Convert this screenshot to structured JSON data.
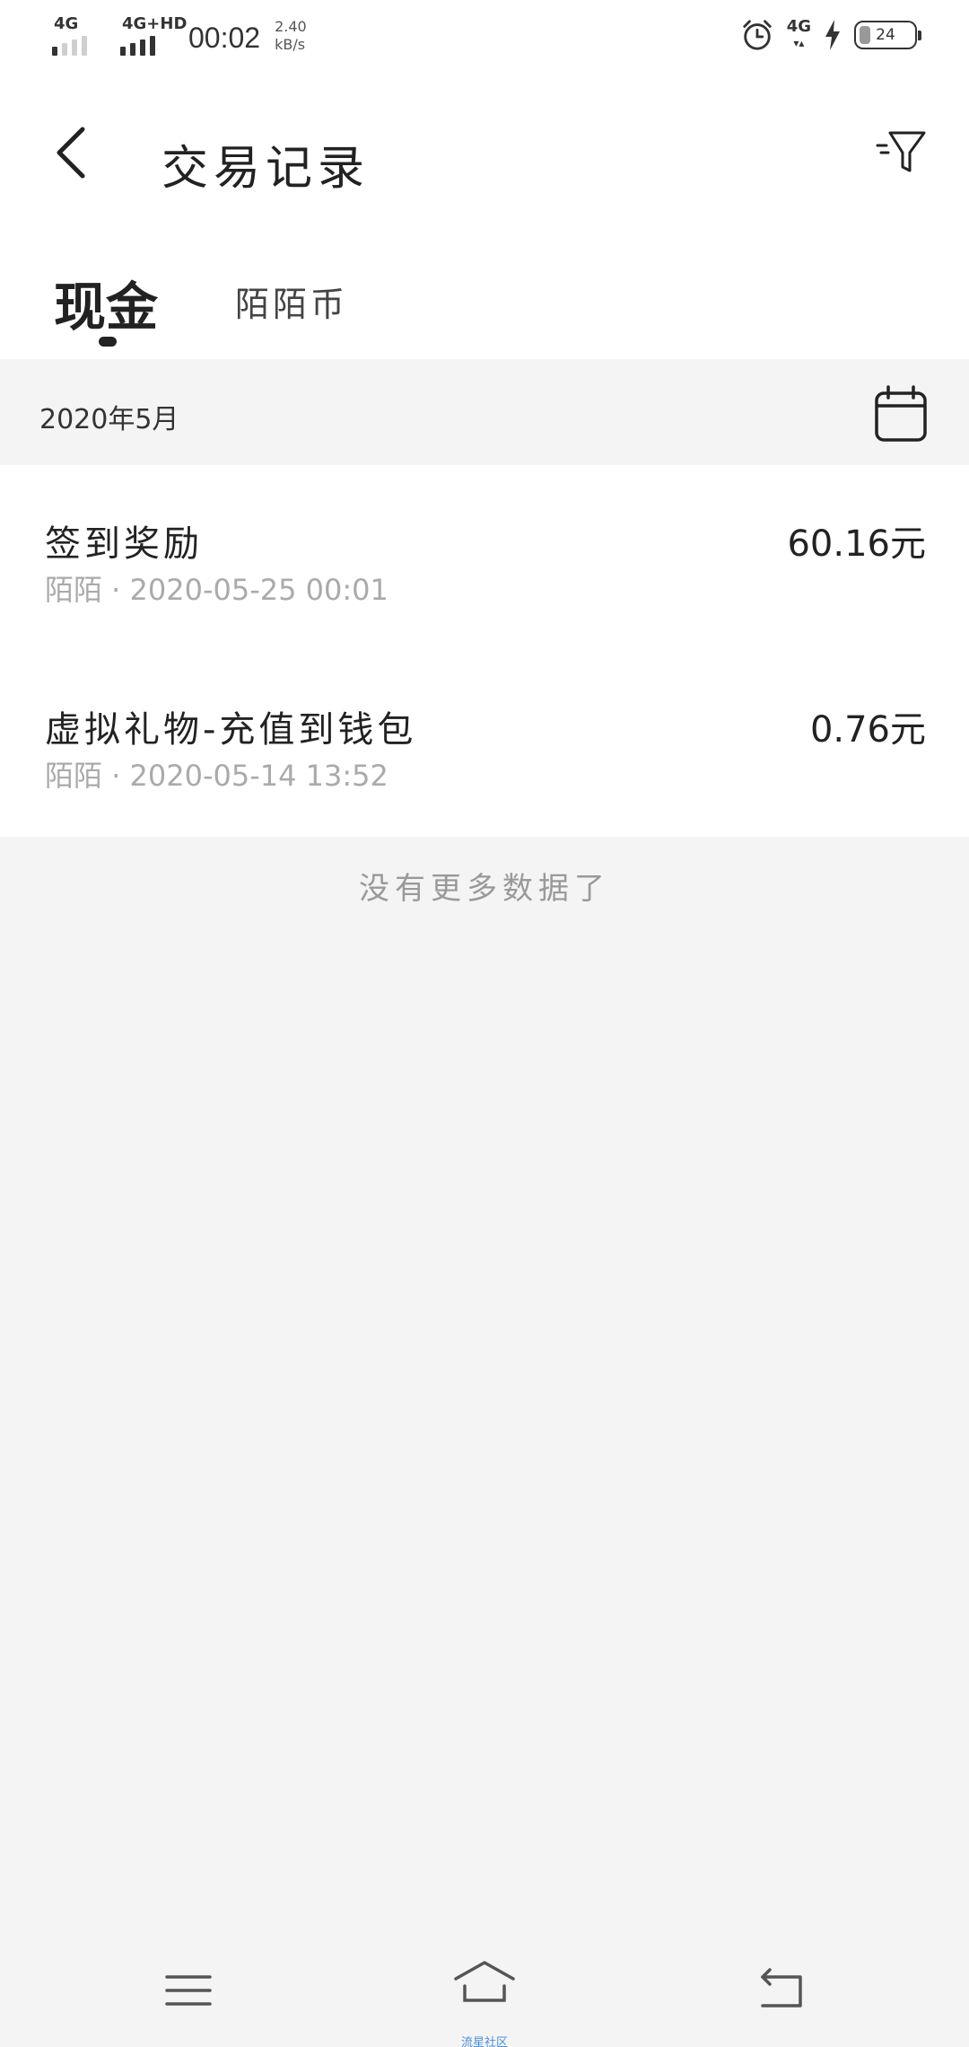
{
  "status_bar": {
    "sim1_network": "4G",
    "sim2_network": "4G+HD",
    "time": "00:02",
    "speed_value": "2.40",
    "speed_unit": "kB/s",
    "right_network": "4G",
    "battery_level": "24"
  },
  "header": {
    "title": "交易记录"
  },
  "tabs": [
    {
      "label": "现金",
      "active": true
    },
    {
      "label": "陌陌币",
      "active": false
    }
  ],
  "month": {
    "label": "2020年5月"
  },
  "transactions": [
    {
      "title": "签到奖励",
      "meta": "陌陌 · 2020-05-25 00:01",
      "amount": "60.16元"
    },
    {
      "title": "虚拟礼物-充值到钱包",
      "meta": "陌陌 · 2020-05-14 13:52",
      "amount": "0.76元"
    }
  ],
  "footer": {
    "no_more_text": "没有更多数据了"
  },
  "nav_bar": {
    "sub_label": "流星社区"
  },
  "colors": {
    "background": "#f4f4f4",
    "card": "#ffffff",
    "text_primary": "#222222",
    "text_secondary": "#aaaaaa"
  },
  "icons": {
    "back": "back-icon",
    "filter": "filter-icon",
    "calendar": "calendar-icon",
    "menu": "menu-icon",
    "home": "home-icon",
    "nav_back": "return-icon",
    "alarm": "alarm-icon",
    "charging": "charging-icon"
  }
}
